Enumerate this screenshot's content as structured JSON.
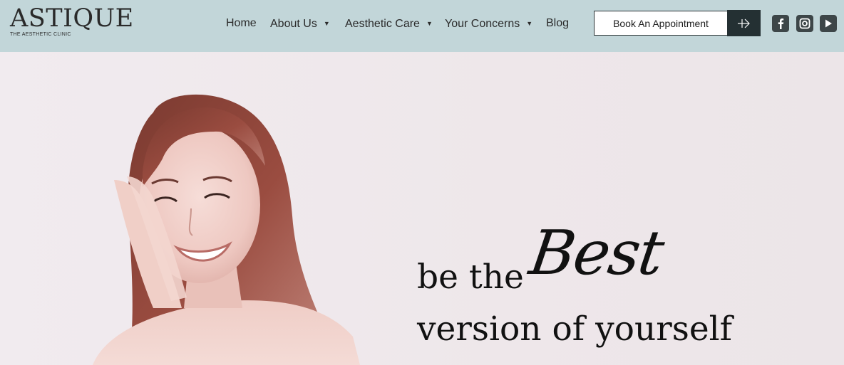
{
  "brand": {
    "name": "ASTIQUE",
    "tagline": "THE AESTHETIC CLINIC"
  },
  "nav": {
    "items": [
      {
        "label": "Home",
        "has_dropdown": false
      },
      {
        "label": "About Us",
        "has_dropdown": true
      },
      {
        "label": "Aesthetic Care",
        "has_dropdown": true
      },
      {
        "label": "Your Concerns",
        "has_dropdown": true
      },
      {
        "label": "Blog",
        "has_dropdown": false
      }
    ]
  },
  "cta": {
    "label": "Book An Appointment",
    "icon": "arrow-right-icon"
  },
  "social": [
    {
      "name": "facebook-icon"
    },
    {
      "name": "instagram-icon"
    },
    {
      "name": "youtube-icon"
    }
  ],
  "hero": {
    "line1_prefix": "be the",
    "line1_emphasis": "Best",
    "line2": "version of yourself"
  },
  "colors": {
    "header_bg": "#c2d6d9",
    "hero_bg": "#efe8ec",
    "button_dark": "#243033",
    "text_dark": "#111111"
  }
}
